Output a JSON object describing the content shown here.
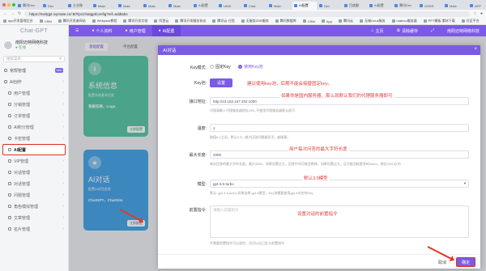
{
  "browser": {
    "tabs": [
      "腾讯Dev",
      "Dev",
      "企业微",
      "Mate",
      "Mate",
      "Mate",
      "Mate",
      "AI配置",
      "UKW",
      "Chat",
      "Mate",
      "AI配置",
      "Dev",
      "百度翻",
      "AI配置",
      "腾讯Dev",
      "OSSR",
      "Mate",
      "APP"
    ],
    "active_tab_index": 11,
    "url": "https://meitgpt.ivymate.cn/:8/#/pc/chatgpt/config?ref=addtabs",
    "bookmarks": [
      "app开发管理后台",
      "CRM",
      "腾讯开发者网站",
      "Webpack教程",
      "腾讯开发文档",
      "阿里云",
      "腾讯开发服务协议",
      "腾讯云·日程",
      "无服务ZDB服务",
      "腾讯数据库",
      "CRM",
      "App",
      "腾讯云",
      "无锡Linux服务",
      "mateco服务器",
      "PPT模板·素材下载",
      "社区平台",
      "运营商"
    ]
  },
  "sidebar": {
    "brand": "Chat-GPT",
    "user_name": "南阳迈特网络科技",
    "user_status": "在线",
    "search_placeholder": "搜索菜单",
    "items": [
      {
        "label": "常规管理",
        "type": "group"
      },
      {
        "label": "AI创作",
        "type": "group"
      },
      {
        "label": "用户管理",
        "type": "sub"
      },
      {
        "label": "分销管理",
        "type": "sub"
      },
      {
        "label": "订单管理",
        "type": "sub"
      },
      {
        "label": "AI积分管理",
        "type": "sub"
      },
      {
        "label": "卡密管理",
        "type": "sub"
      },
      {
        "label": "AI配置",
        "type": "sub",
        "highlight": true
      },
      {
        "label": "VIP管理",
        "type": "sub"
      },
      {
        "label": "对话管理",
        "type": "sub"
      },
      {
        "label": "对话管理",
        "type": "sub"
      },
      {
        "label": "问题管理",
        "type": "sub"
      },
      {
        "label": "角色模拟管理",
        "type": "sub"
      },
      {
        "label": "文章管理",
        "type": "sub"
      },
      {
        "label": "名片管理",
        "type": "sub"
      }
    ],
    "new_badge": "new"
  },
  "topnav": {
    "items": [
      "个人资料",
      "用户管理",
      "AI配置"
    ],
    "right_home": "主页",
    "right_clear": "清除缓存"
  },
  "content": {
    "tabs": [
      "基础配置",
      "平台配置"
    ],
    "card1": {
      "title": "系统信息",
      "subtitle": "配置系统基本信息",
      "footer": "系统名称、Logo",
      "button": "立即配置"
    },
    "card2": {
      "title": "AI对话",
      "subtitle": "配置AI对话信息",
      "footer": "ChatGPT、ChatGlm",
      "button": "立即配置"
    }
  },
  "dialog": {
    "title": "AI对话",
    "fields": {
      "key_mode_label": "Key模式:",
      "key_mode_options": [
        "固定Key",
        "使用Key池"
      ],
      "key_mode_selected": "使用Key池",
      "keypool_label": "Key池:",
      "keypool_button": "设置",
      "api_label": "接口地址:",
      "api_value": "http://43.152.167.202:1000",
      "api_help": "代理请解入代理服务器地址URL,不使用代理服务器默认即可",
      "temp_label": "温度:",
      "temp_value": "1",
      "temp_help": "取值0-1之间，默认0.9，越大回答问题越灵活，越随意。",
      "maxlen_label": "最大长度:",
      "maxlen_value": "2000",
      "maxlen_help": "每次回答的最大字符长度，最大3500，如果设置过大，回答中间可能会断掉，如果设置过大，且可能消耗更多的token，建议2000以内",
      "model_label": "模型:",
      "model_value": "gpt-3.5-turbo",
      "model_help": "默认: gpt-3.5-turbo,如果选择 gpt-4模型，Key池需要使用gpt-4对应的Key",
      "prefix_label": "前置指令:",
      "prefix_placeholder": "请输入前置指令",
      "prefix_help": "不需要前置指令可以留空，也可以自己定义前置指令"
    },
    "notes": {
      "keypool": "建议使用key池，后期不能会接替固定key。",
      "api": "如果你是国内服务器，那么就默认我们的代理服务器即可",
      "maxlen": "用户每次问答的最大字符长度",
      "model": "默认3.5模型",
      "prefix": "设置对话的前置指令"
    },
    "cancel": "取消",
    "confirm": "确定"
  },
  "colors": {
    "accent": "#7b5ae6",
    "annotation": "#e23b3b",
    "card1": "#5cc8a8",
    "card2": "#4aa6e8"
  }
}
